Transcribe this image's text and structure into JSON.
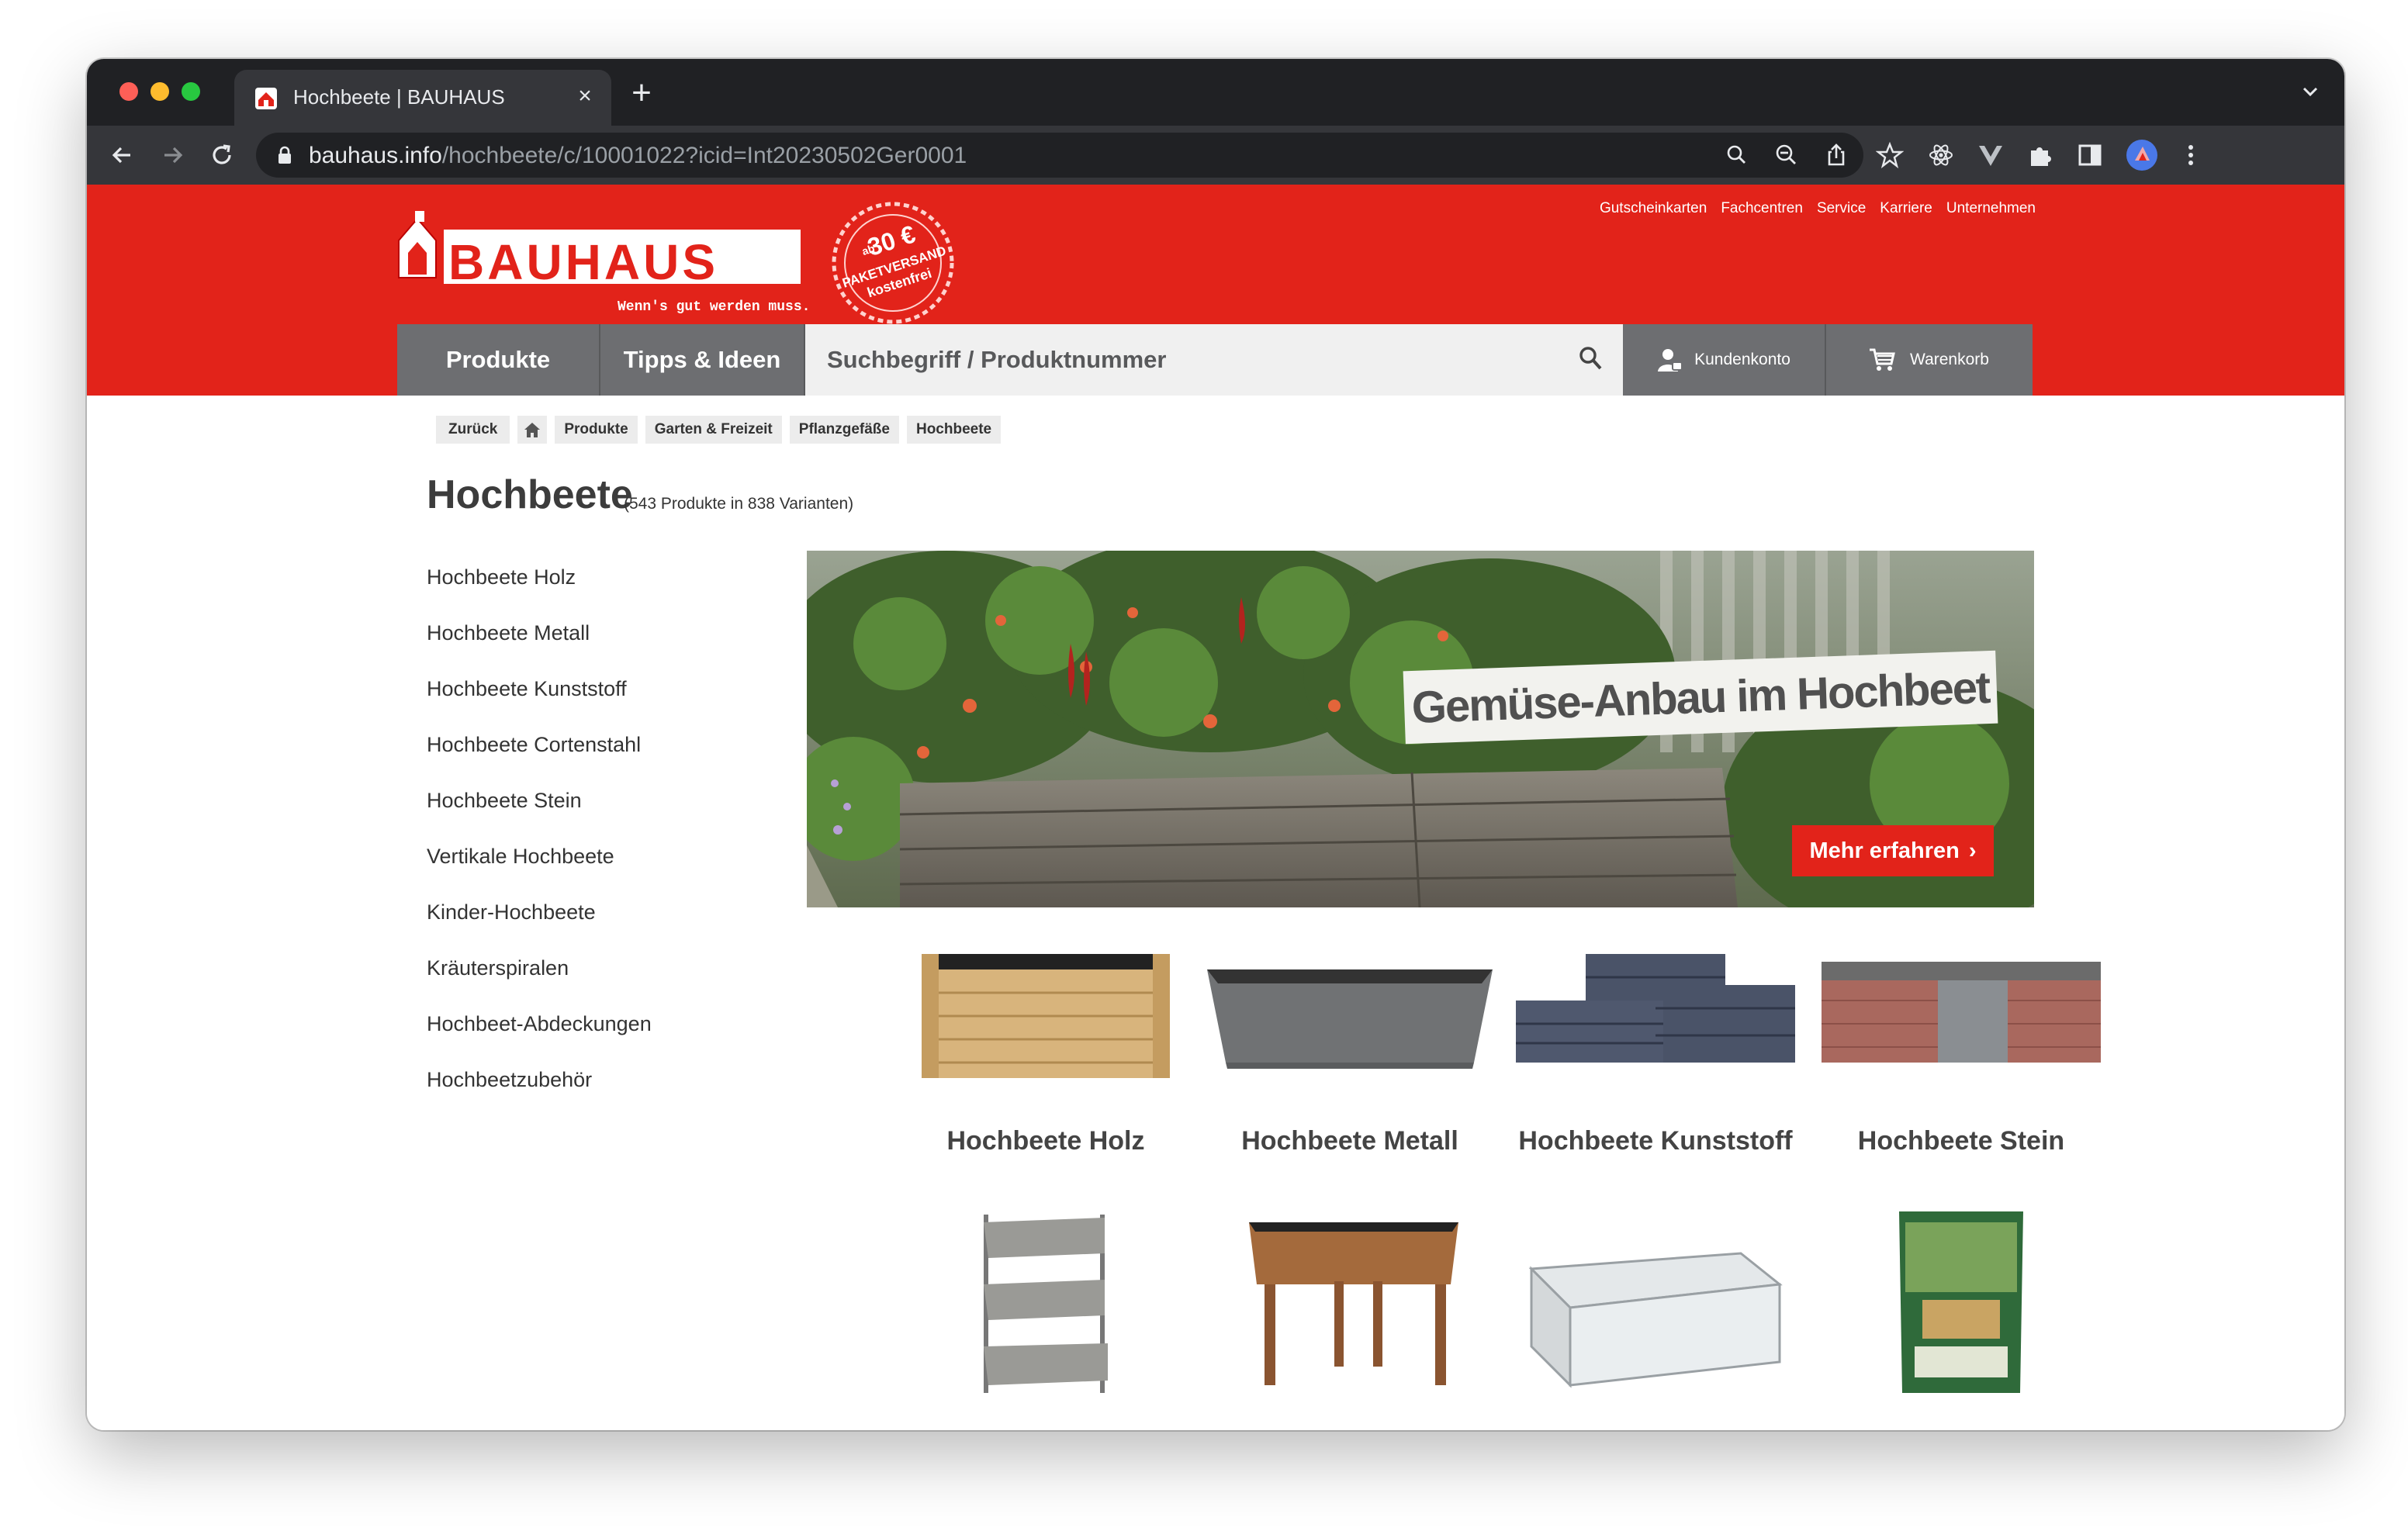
{
  "browser": {
    "tab_title": "Hochbeete | BAUHAUS",
    "tab_close": "×",
    "new_tab": "+",
    "url_host": "bauhaus.info",
    "url_path": "/hochbeete/c/10001022?icid=Int20230502Ger0001"
  },
  "header": {
    "logo_text": "BAUHAUS",
    "slogan": "Wenn's gut werden muss.",
    "stamp": {
      "prefix": "ab",
      "amount": "30 €",
      "line1": "PAKETVERSAND",
      "line2": "kostenfrei"
    },
    "top_links": [
      "Gutscheinkarten",
      "Fachcentren",
      "Service",
      "Karriere",
      "Unternehmen"
    ],
    "nav": {
      "products": "Produkte",
      "tips": "Tipps & Ideen",
      "search_placeholder": "Suchbegriff / Produktnummer",
      "account": "Kundenkonto",
      "cart": "Warenkorb"
    }
  },
  "breadcrumb": {
    "back": "Zurück",
    "items": [
      "Produkte",
      "Garten & Freizeit",
      "Pflanzgefäße",
      "Hochbeete"
    ]
  },
  "page": {
    "title": "Hochbeete",
    "count": "(543 Produkte in 838 Varianten)"
  },
  "sidebar": {
    "items": [
      "Hochbeete Holz",
      "Hochbeete Metall",
      "Hochbeete Kunststoff",
      "Hochbeete Cortenstahl",
      "Hochbeete Stein",
      "Vertikale Hochbeete",
      "Kinder-Hochbeete",
      "Kräuterspiralen",
      "Hochbeet-Abdeckungen",
      "Hochbeetzubehör"
    ]
  },
  "banner": {
    "headline": "Gemüse-Anbau im Hochbeet",
    "button": "Mehr erfahren",
    "button_chevron": "›"
  },
  "categories": [
    "Hochbeete Holz",
    "Hochbeete Metall",
    "Hochbeete Kunststoff",
    "Hochbeete Stein"
  ],
  "colors": {
    "brand_red": "#e2231a",
    "nav_gray": "#6d6e71"
  }
}
